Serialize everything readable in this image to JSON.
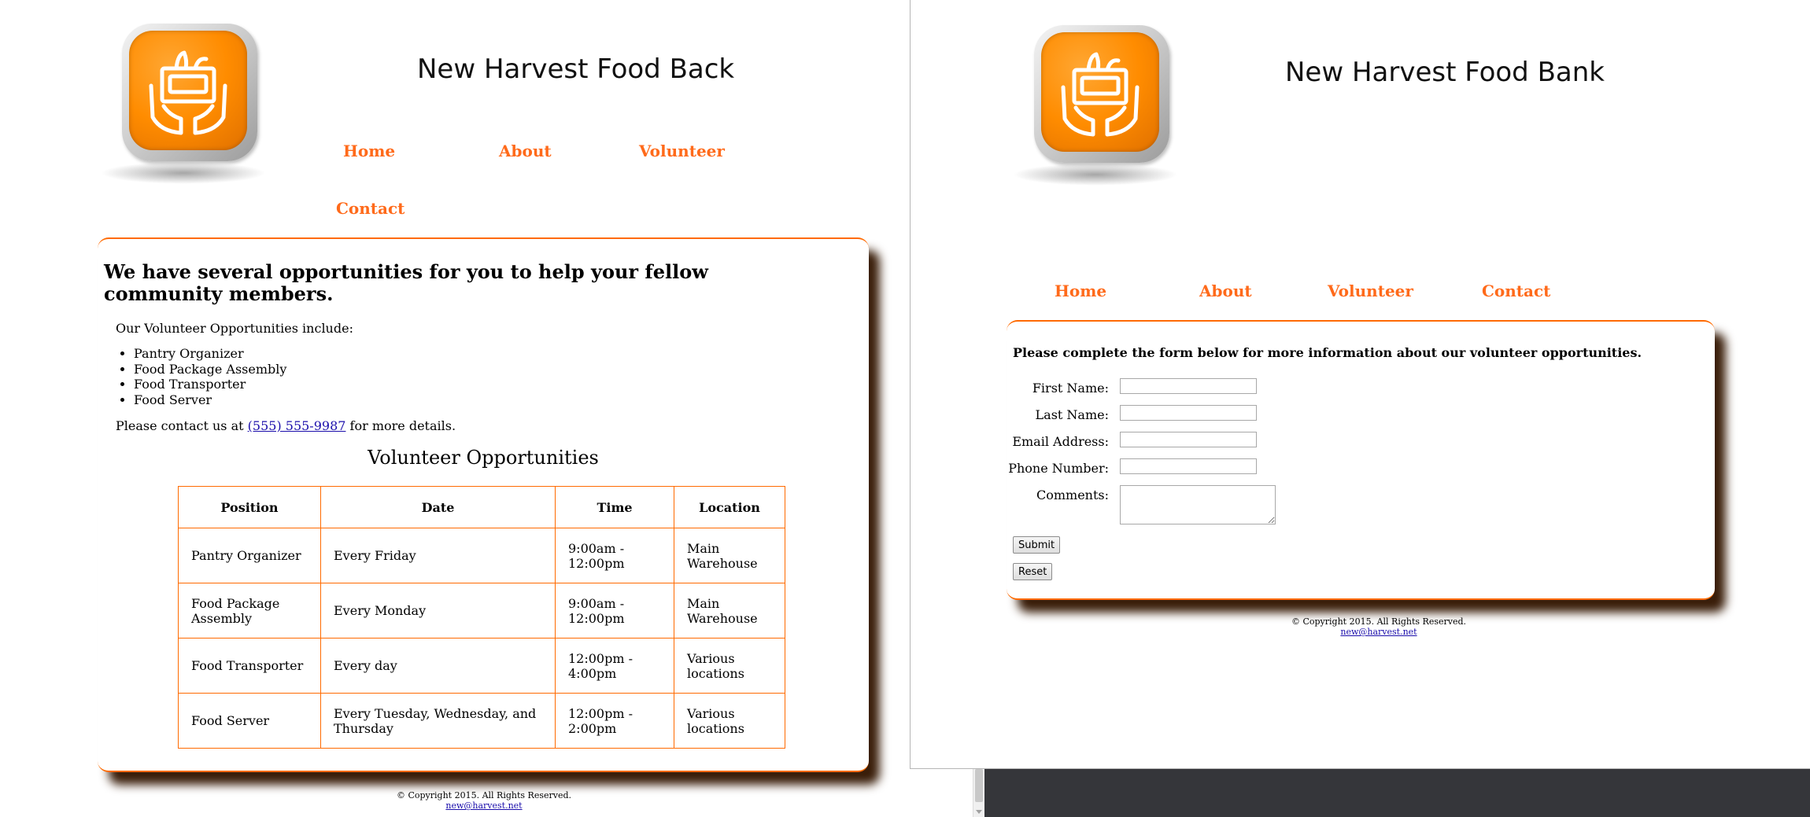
{
  "left": {
    "site_title": "New Harvest Food Back",
    "nav": {
      "home": "Home",
      "about": "About",
      "volunteer": "Volunteer",
      "contact": "Contact"
    },
    "heading": "We have several opportunities for you to help your fellow community members.",
    "intro": "Our Volunteer Opportunities include:",
    "opportunities": [
      "Pantry Organizer",
      "Food Package Assembly",
      "Food Transporter",
      "Food Server"
    ],
    "contact_prefix": "Please contact us at ",
    "contact_phone": "(555) 555-9987",
    "contact_suffix": " for more details.",
    "table_title": "Volunteer Opportunities",
    "table_headers": [
      "Position",
      "Date",
      "Time",
      "Location"
    ],
    "table_rows": [
      [
        "Pantry Organizer",
        "Every Friday",
        "9:00am - 12:00pm",
        "Main Warehouse"
      ],
      [
        "Food Package Assembly",
        "Every Monday",
        "9:00am - 12:00pm",
        "Main Warehouse"
      ],
      [
        "Food Transporter",
        "Every day",
        "12:00pm - 4:00pm",
        "Various locations"
      ],
      [
        "Food Server",
        "Every Tuesday, Wednesday, and Thursday",
        "12:00pm - 2:00pm",
        "Various locations"
      ]
    ],
    "footer_copyright": "© Copyright 2015. All Rights Reserved.",
    "footer_email": "new@harvest.net"
  },
  "right": {
    "site_title": "New Harvest Food Bank",
    "nav": {
      "home": "Home",
      "about": "About",
      "volunteer": "Volunteer",
      "contact": "Contact"
    },
    "form_heading": "Please complete the form below for more information about our volunteer opportunities.",
    "fields": {
      "first_name": "First Name:",
      "last_name": "Last Name:",
      "email": "Email Address:",
      "phone": "Phone Number:",
      "comments": "Comments:"
    },
    "submit_label": "Submit",
    "reset_label": "Reset",
    "footer_copyright": "© Copyright 2015. All Rights Reserved.",
    "footer_email": "new@harvest.net"
  },
  "colors": {
    "accent": "#ff6a00",
    "nav": "#ff6a1a",
    "shadow": "#3a1e0a",
    "desktop": "#35363a"
  },
  "icons": {
    "logo": "hands-holding-food-box-icon"
  }
}
